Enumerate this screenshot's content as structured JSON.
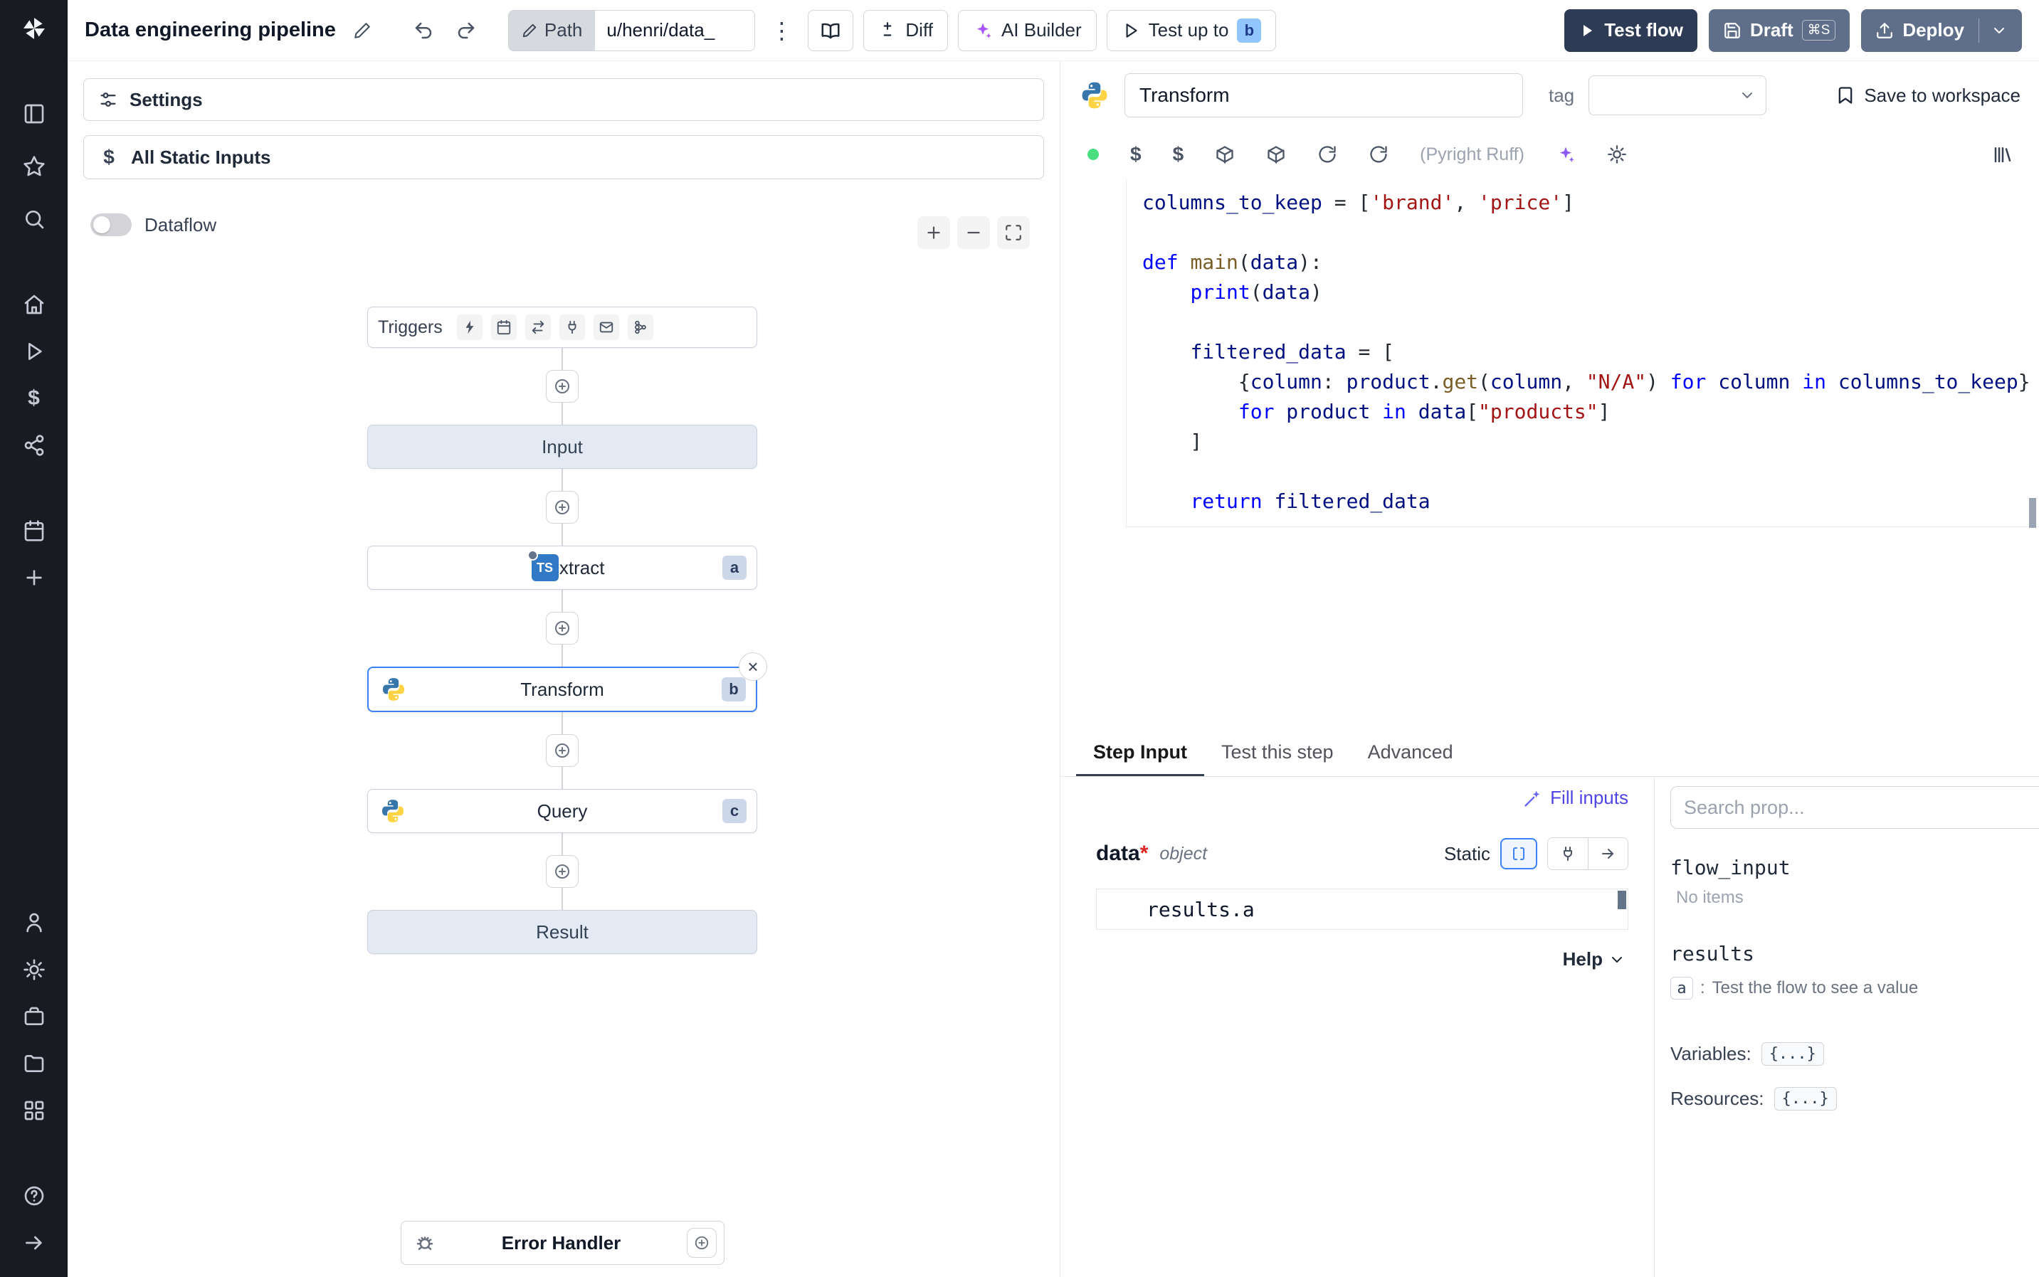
{
  "topbar": {
    "title": "Data engineering pipeline",
    "path_label": "Path",
    "path_value": "u/henri/data_",
    "diff_label": "Diff",
    "ai_builder_label": "AI Builder",
    "test_up_to_label": "Test up to",
    "test_up_to_badge": "b",
    "test_flow_label": "Test flow",
    "draft_label": "Draft",
    "draft_shortcut": "⌘S",
    "deploy_label": "Deploy"
  },
  "icons": {
    "kebab": "⋮",
    "dollar": "$",
    "close": "×"
  },
  "flow": {
    "settings_label": "Settings",
    "static_inputs_label": "All Static Inputs",
    "dataflow_label": "Dataflow",
    "triggers_label": "Triggers",
    "input_label": "Input",
    "extract_label": "Extract",
    "extract_badge": "a",
    "extract_icon_text": "TS",
    "transform_label": "Transform",
    "transform_badge": "b",
    "query_label": "Query",
    "query_badge": "c",
    "result_label": "Result",
    "error_handler_label": "Error Handler"
  },
  "editor": {
    "step_name": "Transform",
    "tag_label": "tag",
    "save_label": "Save to workspace",
    "lint_label": "(Pyright Ruff)",
    "code_tokens": [
      [
        [
          "v",
          "columns_to_keep"
        ],
        [
          "p",
          " = ["
        ],
        [
          "s",
          "'brand'"
        ],
        [
          "p",
          ", "
        ],
        [
          "s",
          "'price'"
        ],
        [
          "p",
          "]"
        ]
      ],
      [],
      [
        [
          "k",
          "def"
        ],
        [
          "p",
          " "
        ],
        [
          "f",
          "main"
        ],
        [
          "p",
          "("
        ],
        [
          "v",
          "data"
        ],
        [
          "p",
          "):"
        ]
      ],
      [
        [
          "p",
          "    "
        ],
        [
          "k",
          "print"
        ],
        [
          "p",
          "("
        ],
        [
          "v",
          "data"
        ],
        [
          "p",
          ")"
        ]
      ],
      [],
      [
        [
          "p",
          "    "
        ],
        [
          "v",
          "filtered_data"
        ],
        [
          "p",
          " = ["
        ]
      ],
      [
        [
          "p",
          "        {"
        ],
        [
          "v",
          "column"
        ],
        [
          "p",
          ": "
        ],
        [
          "v",
          "product"
        ],
        [
          "p",
          "."
        ],
        [
          "f",
          "get"
        ],
        [
          "p",
          "("
        ],
        [
          "v",
          "column"
        ],
        [
          "p",
          ", "
        ],
        [
          "s",
          "\"N/A\""
        ],
        [
          "p",
          ") "
        ],
        [
          "k",
          "for"
        ],
        [
          "p",
          " "
        ],
        [
          "v",
          "column"
        ],
        [
          "p",
          " "
        ],
        [
          "k",
          "in"
        ],
        [
          "p",
          " "
        ],
        [
          "v",
          "columns_to_keep"
        ],
        [
          "p",
          "}"
        ]
      ],
      [
        [
          "p",
          "        "
        ],
        [
          "k",
          "for"
        ],
        [
          "p",
          " "
        ],
        [
          "v",
          "product"
        ],
        [
          "p",
          " "
        ],
        [
          "k",
          "in"
        ],
        [
          "p",
          " "
        ],
        [
          "v",
          "data"
        ],
        [
          "p",
          "["
        ],
        [
          "s",
          "\"products\""
        ],
        [
          "p",
          "]"
        ]
      ],
      [
        [
          "p",
          "    ]"
        ]
      ],
      [],
      [
        [
          "p",
          "    "
        ],
        [
          "k",
          "return"
        ],
        [
          "p",
          " "
        ],
        [
          "v",
          "filtered_data"
        ]
      ]
    ]
  },
  "bottom": {
    "tabs": [
      "Step Input",
      "Test this step",
      "Advanced"
    ],
    "active_tab": "Step Input",
    "fill_inputs_label": "Fill inputs",
    "arg_name": "data",
    "arg_required": "*",
    "arg_type": "object",
    "static_label": "Static",
    "expr_value": "results.a",
    "help_label": "Help"
  },
  "prop": {
    "search_placeholder": "Search prop...",
    "flow_input_label": "flow_input",
    "no_items_label": "No items",
    "results_label": "results",
    "result_badge": "a",
    "result_colon": ":",
    "result_hint": "Test the flow to see a value",
    "variables_label": "Variables:",
    "variables_value": "{...}",
    "resources_label": "Resources:",
    "resources_value": "{...}"
  }
}
